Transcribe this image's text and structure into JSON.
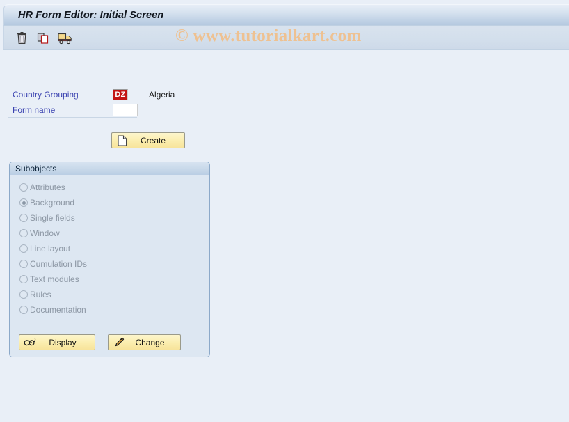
{
  "window": {
    "title": "HR Form Editor: Initial Screen"
  },
  "watermark": {
    "text": "© www.tutorialkart.com"
  },
  "toolbar": {
    "buttons": [
      {
        "name": "delete-icon",
        "tooltip": "Delete"
      },
      {
        "name": "copy-icon",
        "tooltip": "Copy"
      },
      {
        "name": "transport-icon",
        "tooltip": "Transport"
      }
    ]
  },
  "form": {
    "country_grouping": {
      "label": "Country Grouping",
      "value": "DZ",
      "description": "Algeria",
      "value_bg": "#c31515",
      "value_fg": "#ffffff"
    },
    "form_name": {
      "label": "Form name",
      "value": "",
      "placeholder": ""
    },
    "create_button": {
      "label": "Create",
      "icon": "new-document-icon"
    }
  },
  "subobjects": {
    "title": "Subobjects",
    "options": [
      {
        "label": "Attributes",
        "selected": false
      },
      {
        "label": "Background",
        "selected": true
      },
      {
        "label": "Single fields",
        "selected": false
      },
      {
        "label": "Window",
        "selected": false
      },
      {
        "label": "Line layout",
        "selected": false
      },
      {
        "label": "Cumulation IDs",
        "selected": false
      },
      {
        "label": "Text modules",
        "selected": false
      },
      {
        "label": "Rules",
        "selected": false
      },
      {
        "label": "Documentation",
        "selected": false
      }
    ],
    "display_button": {
      "label": "Display",
      "icon": "glasses-icon"
    },
    "change_button": {
      "label": "Change",
      "icon": "pencil-icon"
    }
  },
  "colors": {
    "background": "#e9eff7",
    "titlebar_start": "#e7eef7",
    "titlebar_end": "#b5c9e0",
    "label_blue": "#3a42b0",
    "button_yellow": "#fbeeb0",
    "panel_border": "#8ca9c9",
    "watermark": "#eec191"
  }
}
